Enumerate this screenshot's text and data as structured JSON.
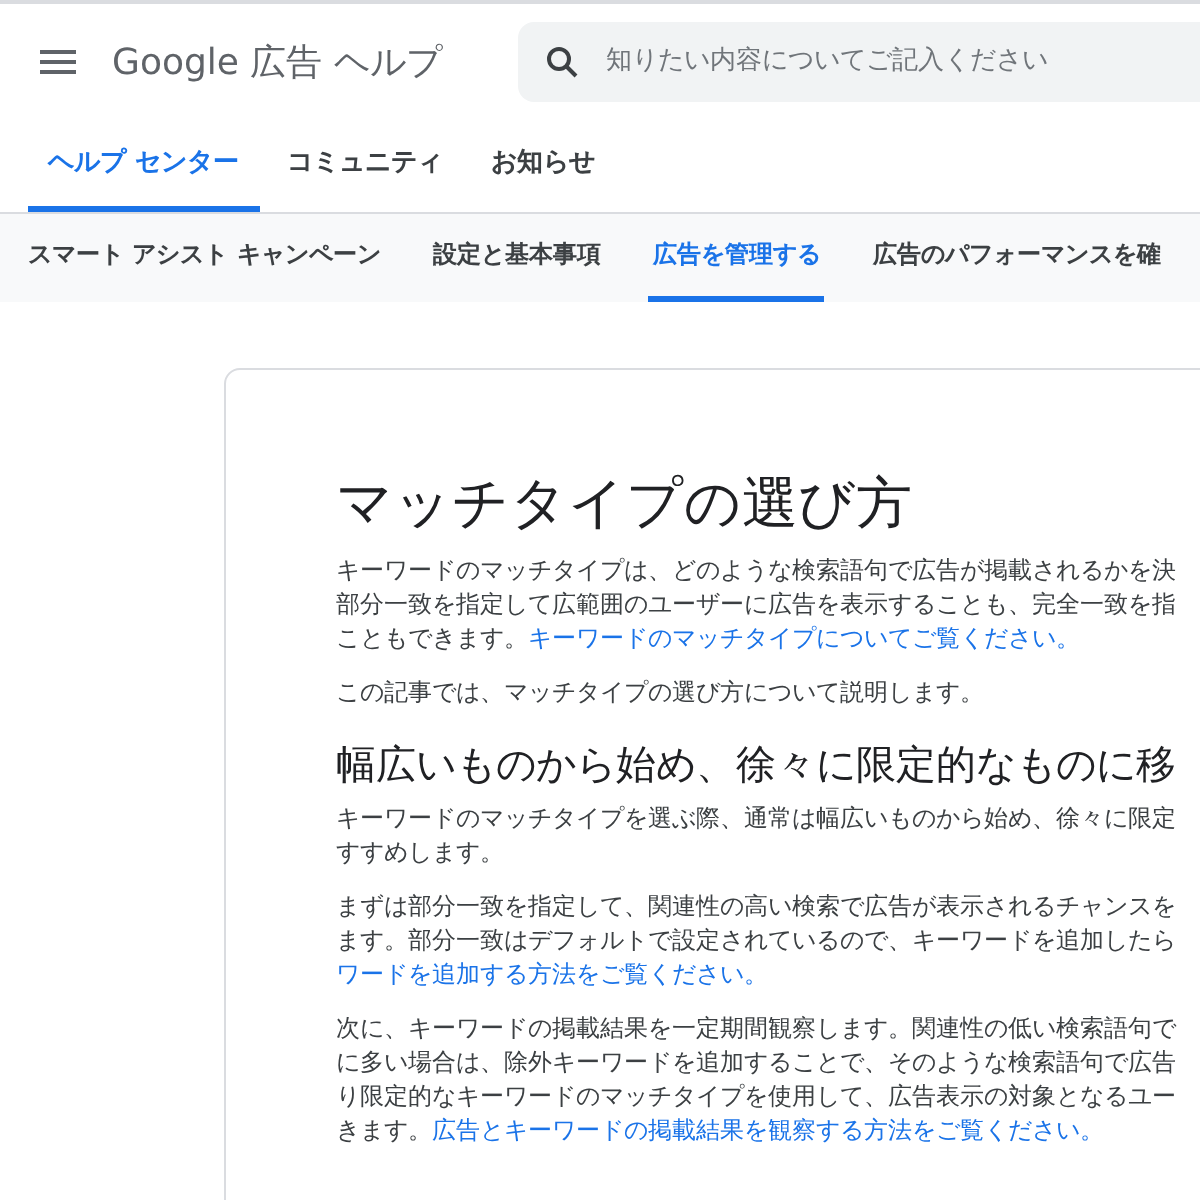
{
  "header": {
    "title": "Google 広告 ヘルプ",
    "search": {
      "placeholder": "知りたい内容についてご記入ください"
    }
  },
  "tabs": [
    {
      "label": "ヘルプ センター",
      "selected": true
    },
    {
      "label": "コミュニティ",
      "selected": false
    },
    {
      "label": "お知らせ",
      "selected": false
    }
  ],
  "subnav": [
    {
      "label": "スマート アシスト キャンペーン",
      "selected": false
    },
    {
      "label": "設定と基本事項",
      "selected": false
    },
    {
      "label": "広告を管理する",
      "selected": true
    },
    {
      "label": "広告のパフォーマンスを確",
      "selected": false
    }
  ],
  "article": {
    "title": "マッチタイプの選び方",
    "blocks": [
      {
        "kind": "paragraph",
        "lines": [
          [
            {
              "text": "キーワードのマッチタイプは、どのような検索語句で広告が掲載されるかを決"
            }
          ],
          [
            {
              "text": "部分一致を指定して広範囲のユーザーに広告を表示することも、完全一致を指"
            }
          ],
          [
            {
              "text": "こともできます。"
            },
            {
              "text": "キーワードのマッチタイプについてご覧ください。",
              "kind": "link"
            }
          ]
        ]
      },
      {
        "kind": "paragraph",
        "lines": [
          [
            {
              "text": "この記事では、マッチタイプの選び方について説明します。"
            }
          ]
        ]
      },
      {
        "kind": "heading",
        "text": "幅広いものから始め、徐々に限定的なものに移"
      },
      {
        "kind": "paragraph",
        "lines": [
          [
            {
              "text": "キーワードのマッチタイプを選ぶ際、通常は幅広いものから始め、徐々に限定"
            }
          ],
          [
            {
              "text": "すすめします。"
            }
          ]
        ]
      },
      {
        "kind": "paragraph",
        "lines": [
          [
            {
              "text": "まずは部分一致を指定して、関連性の高い検索で広告が表示されるチャンスを"
            }
          ],
          [
            {
              "text": "ます。部分一致はデフォルトで設定されているので、キーワードを追加したら"
            }
          ],
          [
            {
              "text": "ワードを追加する方法をご覧ください。",
              "kind": "link"
            }
          ]
        ]
      },
      {
        "kind": "paragraph",
        "lines": [
          [
            {
              "text": "次に、キーワードの掲載結果を一定期間観察します。関連性の低い検索語句で"
            }
          ],
          [
            {
              "text": "に多い場合は、除外キーワードを追加することで、そのような検索語句で広告"
            }
          ],
          [
            {
              "text": "り限定的なキーワードのマッチタイプを使用して、広告表示の対象となるユー"
            }
          ],
          [
            {
              "text": "きます。"
            },
            {
              "text": "広告とキーワードの掲載結果を観察する方法をご覧ください。",
              "kind": "link"
            }
          ]
        ]
      }
    ]
  }
}
